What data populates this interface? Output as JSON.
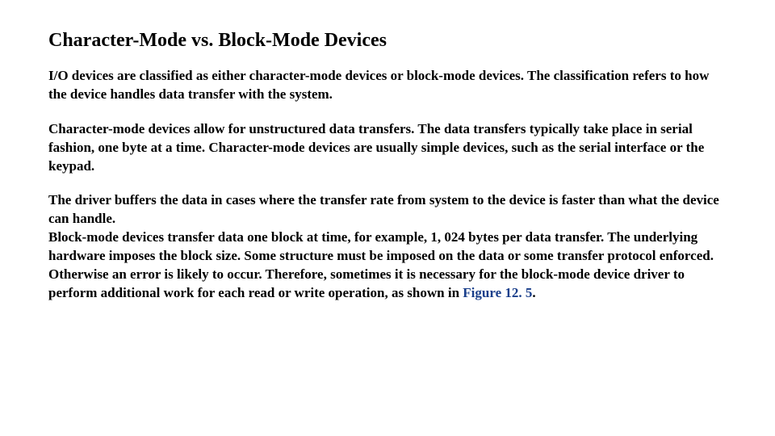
{
  "heading": "Character-Mode vs. Block-Mode Devices",
  "p1": "I/O devices are classified as either character-mode devices or block-mode devices. The classification refers to how the device handles data transfer with the system.",
  "p2": "Character-mode devices allow for unstructured data transfers. The data transfers typically take place in serial fashion, one byte at a time. Character-mode devices are usually simple devices, such as the serial interface or the keypad.",
  "p3a": "The driver buffers the data in cases where the transfer rate from system to the device is faster than what the device can handle.",
  "p3b": "Block-mode devices transfer data one block at time, for example, 1, 024 bytes per data transfer. The underlying hardware imposes the block size. Some structure must be imposed on the data or some transfer protocol enforced.",
  "p3c_pre": "Otherwise an error is likely to occur. Therefore, sometimes it is necessary for the block-mode device driver to perform additional work for each read or write operation, as shown in ",
  "p3c_link": "Figure 12. 5",
  "p3c_post": "."
}
